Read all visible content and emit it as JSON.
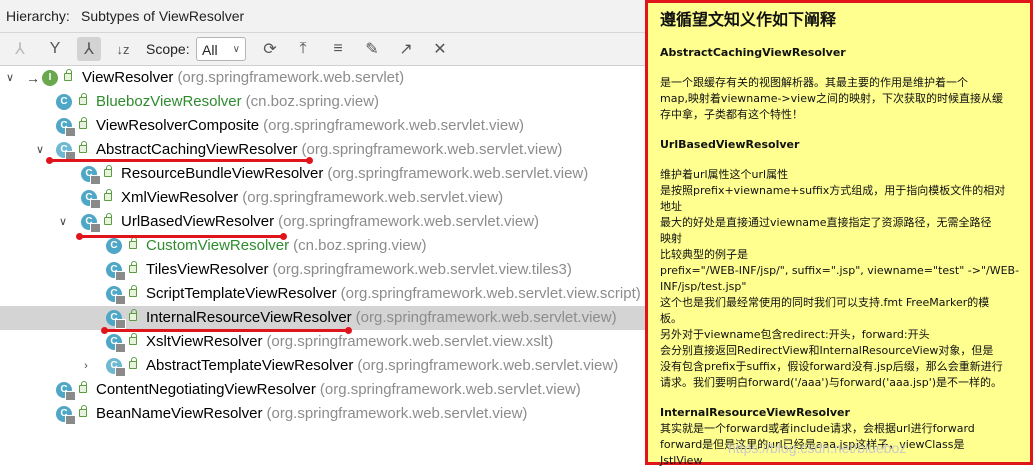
{
  "hierarchy": {
    "label": "Hierarchy:",
    "title": "Subtypes of ViewResolver"
  },
  "toolbar": {
    "scope_label": "Scope:",
    "scope_value": "All",
    "icons": [
      "supertypes-hierarchy-icon",
      "subtypes-hierarchy-icon",
      "class-hierarchy-icon",
      "sort-alphabetically-icon",
      "refresh-icon",
      "export-icon",
      "collapse-all-icon",
      "pin-icon",
      "open-in-window-icon",
      "close-icon"
    ]
  },
  "tree": [
    {
      "name": "ViewResolver",
      "pkg": "(org.springframework.web.servlet)",
      "expanded": true,
      "interface": true
    },
    {
      "name": "BluebozViewResolver",
      "pkg": "(cn.boz.spring.view)",
      "green": true
    },
    {
      "name": "ViewResolverComposite",
      "pkg": "(org.springframework.web.servlet.view)"
    },
    {
      "name": "AbstractCachingViewResolver",
      "pkg": "(org.springframework.web.servlet.view)",
      "expanded": true
    },
    {
      "name": "ResourceBundleViewResolver",
      "pkg": "(org.springframework.web.servlet.view)"
    },
    {
      "name": "XmlViewResolver",
      "pkg": "(org.springframework.web.servlet.view)"
    },
    {
      "name": "UrlBasedViewResolver",
      "pkg": "(org.springframework.web.servlet.view)",
      "expanded": true
    },
    {
      "name": "CustomViewResolver",
      "pkg": "(cn.boz.spring.view)",
      "green": true
    },
    {
      "name": "TilesViewResolver",
      "pkg": "(org.springframework.web.servlet.view.tiles3)"
    },
    {
      "name": "ScriptTemplateViewResolver",
      "pkg": "(org.springframework.web.servlet.view.script)"
    },
    {
      "name": "InternalResourceViewResolver",
      "pkg": "(org.springframework.web.servlet.view)",
      "selected": true
    },
    {
      "name": "XsltViewResolver",
      "pkg": "(org.springframework.web.servlet.view.xslt)"
    },
    {
      "name": "AbstractTemplateViewResolver",
      "pkg": "(org.springframework.web.servlet.view)",
      "collapsed": true
    },
    {
      "name": "ContentNegotiatingViewResolver",
      "pkg": "(org.springframework.web.servlet.view)"
    },
    {
      "name": "BeanNameViewResolver",
      "pkg": "(org.springframework.web.servlet.view)"
    }
  ],
  "note": {
    "title": "遵循望文知义作如下阐释",
    "s1_head": "AbstractCachingViewResolver",
    "s1_l1": "是一个跟缓存有关的视图解析器。其最主要的作用是维护着一个",
    "s1_l2": "map,映射着viewname->view之间的映射，下次获取的时候直接从缓",
    "s1_l3": "存中拿，子类都有这个特性！",
    "s2_head": "UrlBasedViewResolver",
    "s2_l1": "维护着url属性这个url属性",
    "s2_l2": "是按照prefix+viewname+suffix方式组成，用于指向模板文件的相对",
    "s2_l3": "地址",
    "s2_l4": "最大的好处是直接通过viewname直接指定了资源路径，无需全路径",
    "s2_l5": "映射",
    "s2_l6": "比较典型的例子是",
    "s2_l7": "prefix=\"/WEB-INF/jsp/\", suffix=\".jsp\", viewname=\"test\" ->\"/WEB-",
    "s2_l8": "INF/jsp/test.jsp\"",
    "s2_l9": "这个也是我们最经常使用的同时我们可以支持.fmt FreeMarker的模",
    "s2_l10": "板。",
    "s2_l11": "另外对于viewname包含redirect:开头，forward:开头",
    "s2_l12": "会分别直接返回RedirectView和InternalResourceView对象，但是",
    "s2_l13": "没有包含prefix于suffix，假设forward没有.jsp后缀，那么会重新进行",
    "s2_l14": "请求。我们要明白forward('/aaa')与forward('aaa.jsp')是不一样的。",
    "s3_head": "InternalResourceViewResolver",
    "s3_l1": "其实就是一个forward或者include请求，会根据url进行forward",
    "s3_l2": "forward是但是这里的url已经是aaa.jsp这样子，viewClass是",
    "s3_l3": "JstlView"
  },
  "watermark": "https://blog.csdn.net/blueboz",
  "colors": {
    "annotation": "#e0151c",
    "note_bg": "#ffff90",
    "selected_row": "#d4d4d4",
    "package": "#8c8c8c",
    "project_class": "#2e8b2e"
  }
}
